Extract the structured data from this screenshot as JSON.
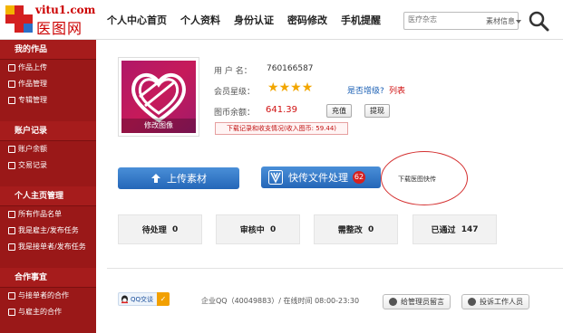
{
  "logo": {
    "url_text": "vitu1.com",
    "cn_text": "医图网"
  },
  "nav": [
    "个人中心首页",
    "个人资料",
    "身份认证",
    "密码修改",
    "手机提醒"
  ],
  "search": {
    "placeholder": "医疗杂志",
    "select_value": "素材信息"
  },
  "sidebar": {
    "sections": [
      {
        "title": "我的作品",
        "items": [
          "作品上传",
          "作品管理",
          "专辑管理"
        ]
      },
      {
        "title": "账户记录",
        "items": [
          "账户余额",
          "交易记录"
        ]
      },
      {
        "title": "个人主页管理",
        "items": [
          "所有作品名单",
          "我是雇主/发布任务",
          "我是接单者/发布任务"
        ]
      },
      {
        "title": "合作事宜",
        "items": [
          "与接单者的合作",
          "与雇主的合作"
        ]
      }
    ]
  },
  "profile": {
    "avatar_caption": "修改图像",
    "username_label": "用 户 名：",
    "username": "760166587",
    "level_label": "会员星级：",
    "stars": 4,
    "upgrade_text": "是否增级?",
    "list_text": "列表",
    "coins_label": "图币余额：",
    "coins": "641.39",
    "recharge_label": "充值",
    "withdraw_label": "提现",
    "records_text": "下载记录和收支情况(收入图币: 59.44)"
  },
  "actions": {
    "upload_label": "上传素材",
    "fast_label": "快传文件处理",
    "fast_badge": "62",
    "fast_note": "下载医图快传"
  },
  "status": [
    {
      "label": "待处理",
      "count": "0"
    },
    {
      "label": "审核中",
      "count": "0"
    },
    {
      "label": "需整改",
      "count": "0"
    },
    {
      "label": "已通过",
      "count": "147"
    }
  ],
  "footer": {
    "qq_label": "QQ交谈",
    "qq_info": "企业QQ（40049883）/ 在线时间 08:00-23:30",
    "msg_btn": "给管理员留言",
    "complain_btn": "投诉工作人员"
  },
  "colors": {
    "sidebar": "#9a1818",
    "accent_red": "#d01010",
    "button_blue": "#2466b8",
    "star": "#f2a600"
  }
}
